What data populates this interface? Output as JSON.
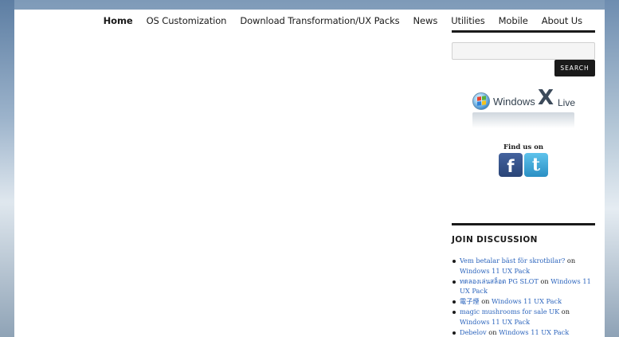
{
  "nav": {
    "items": [
      {
        "label": "Home",
        "active": true
      },
      {
        "label": "OS Customization"
      },
      {
        "label": "Download Transformation/UX Packs"
      },
      {
        "label": "News"
      },
      {
        "label": "Utilities"
      },
      {
        "label": "Mobile"
      },
      {
        "label": "About Us"
      }
    ]
  },
  "sidebar": {
    "search": {
      "value": "",
      "button_label": "Search"
    },
    "windows_live": {
      "brand": "Windows",
      "x": "X",
      "live": "Live"
    },
    "find_us": "Find us on",
    "social": [
      {
        "network": "facebook",
        "glyph": "f",
        "color": "#3b5998"
      },
      {
        "network": "twitter",
        "glyph": "t",
        "color": "#33a8dc"
      }
    ],
    "discussion": {
      "title": "JOIN DISCUSSION",
      "comments": [
        {
          "author": "Vem betalar bäst för skrotbilar?",
          "on": "on",
          "post": "Windows 11 UX Pack"
        },
        {
          "author": "ทดลองเล่นสล็อต PG SLOT",
          "on": "on",
          "post": "Windows 11 UX Pack"
        },
        {
          "author": "電子煙",
          "on": "on",
          "post": "Windows 11 UX Pack"
        },
        {
          "author": "magic mushrooms for sale UK",
          "on": "on",
          "post": "Windows 11 UX Pack"
        },
        {
          "author": "Debelov",
          "on": "on",
          "post": "Windows 11 UX Pack"
        }
      ]
    }
  },
  "colors": {
    "text": "#1a1a1a",
    "link": "#2b64bd",
    "rule": "#1a1a1a"
  }
}
